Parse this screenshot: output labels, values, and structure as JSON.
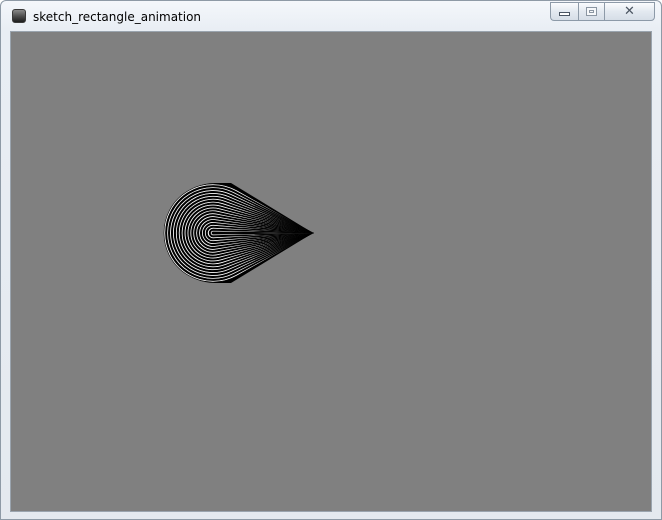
{
  "window": {
    "title": "sketch_rectangle_animation",
    "app_icon": "processing-app-icon",
    "buttons": {
      "minimize_icon": "minimize-icon",
      "maximize_icon": "maximize-icon",
      "close_icon": "close-icon",
      "close_glyph": "✕"
    }
  },
  "canvas": {
    "background_color": "#808080",
    "stroke_color": "#000000",
    "fill_color": "#ffffff",
    "shape": "teardrop-animation-trail"
  }
}
